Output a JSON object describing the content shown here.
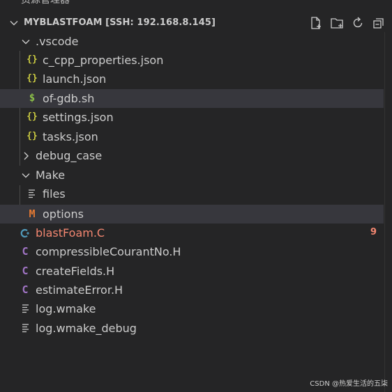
{
  "panel": {
    "top_title": "资源管理器",
    "workspace_title": "MYBLASTFOAM [SSH: 192.168.8.145]"
  },
  "toolbar": {
    "actions": [
      "new-file-icon",
      "new-folder-icon",
      "refresh-icon",
      "collapse-all-icon"
    ]
  },
  "tree": {
    "vscode": {
      "label": ".vscode",
      "items": [
        {
          "label": "c_cpp_properties.json",
          "icon": "{}",
          "color": "#cbcb41"
        },
        {
          "label": "launch.json",
          "icon": "{}",
          "color": "#cbcb41"
        },
        {
          "label": "of-gdb.sh",
          "icon": "$",
          "color": "#8dc149"
        },
        {
          "label": "settings.json",
          "icon": "{}",
          "color": "#cbcb41"
        },
        {
          "label": "tasks.json",
          "icon": "{}",
          "color": "#cbcb41"
        }
      ]
    },
    "debug_case": {
      "label": "debug_case"
    },
    "make": {
      "label": "Make",
      "items": [
        {
          "label": "files",
          "icon": "≡",
          "color": "#cccccc"
        },
        {
          "label": "options",
          "icon": "M",
          "color": "#e37933"
        }
      ]
    },
    "root_files": [
      {
        "label": "blastFoam.C",
        "icon": "C",
        "color": "#519aba",
        "badge": "9"
      },
      {
        "label": "compressibleCourantNo.H",
        "icon": "C",
        "color": "#a074c4"
      },
      {
        "label": "createFields.H",
        "icon": "C",
        "color": "#a074c4"
      },
      {
        "label": "estimateError.H",
        "icon": "C",
        "color": "#a074c4"
      },
      {
        "label": "log.wmake",
        "icon": "≡",
        "color": "#cccccc"
      },
      {
        "label": "log.wmake_debug",
        "icon": "≡",
        "color": "#cccccc"
      }
    ]
  },
  "colors": {
    "background": "#252526",
    "selected_row": "#37373d",
    "error_text": "#f48771",
    "json_icon": "#cbcb41",
    "shell_icon": "#8dc149",
    "header_icon": "#a074c4",
    "makefile_icon": "#e37933"
  },
  "watermark": "CSDN @热爱生活的五柒"
}
